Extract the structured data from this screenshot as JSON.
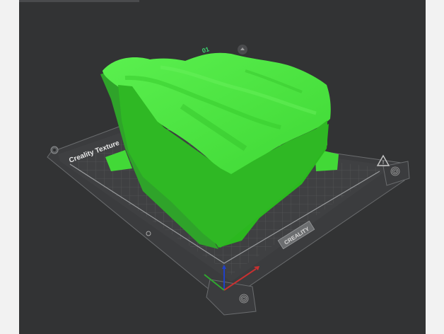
{
  "viewport": {
    "background_color": "#323334",
    "model_color": "#44e53a"
  },
  "plate": {
    "label_left": "Creality Texture",
    "label_right": "CREALITY",
    "plate_number": "01",
    "plate_color": "#3d3e40",
    "grid_color": "#5e6062"
  },
  "icons": {
    "left": "settings-pin-icon",
    "right_triangle": "warning-triangle-icon",
    "fingerprint": "fingerprint-icon"
  },
  "axes": {
    "x_color": "#c83030",
    "y_color": "#2fa82f",
    "z_color": "#2040c8"
  }
}
